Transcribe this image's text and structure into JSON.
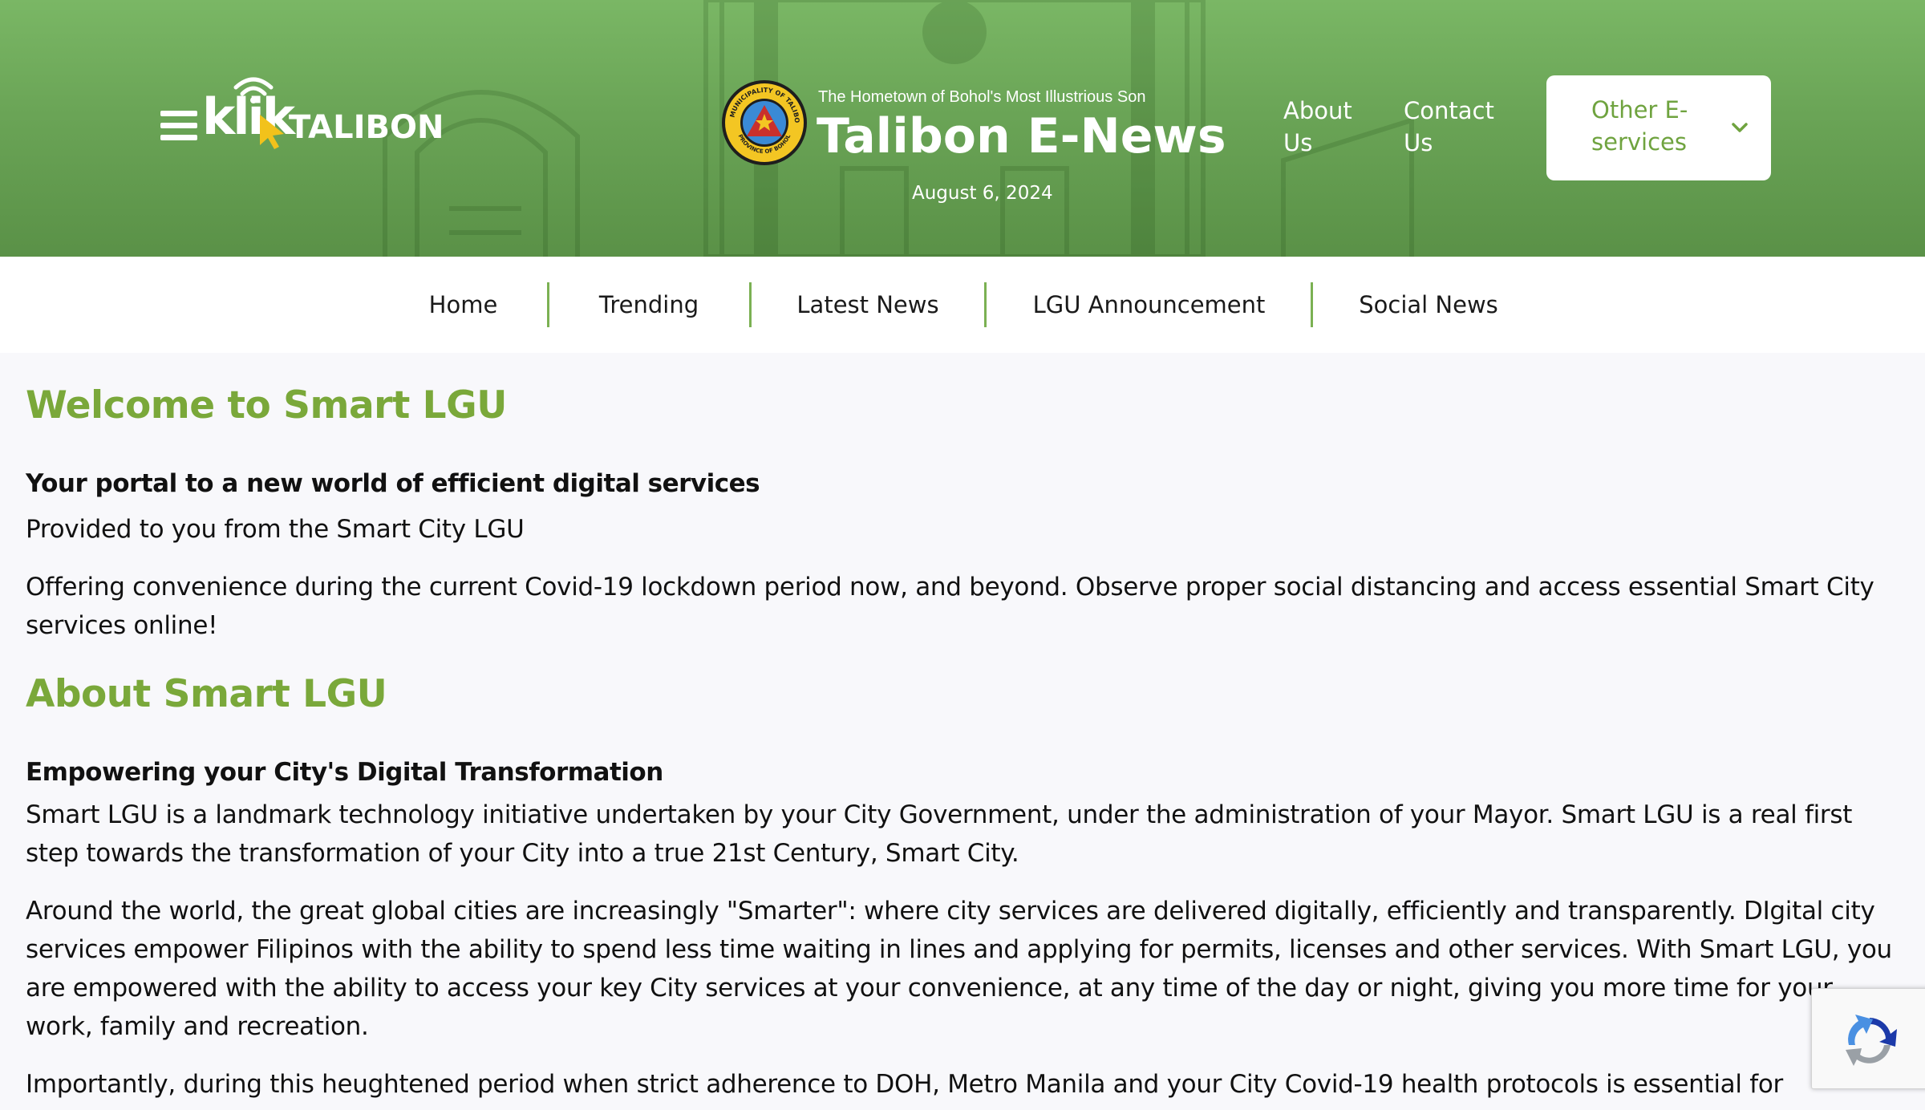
{
  "header": {
    "logo": {
      "brand": "klik",
      "town": "TALIBON"
    },
    "seal": {
      "text_top": "MUNICIPALITY OF TALIBON",
      "text_bottom": "PROVINCE OF BOHOL"
    },
    "tagline": "The Hometown of Bohol's Most Illustrious Son",
    "title": "Talibon E-News",
    "date": "August 6, 2024",
    "links": {
      "about": "About Us",
      "contact": "Contact Us"
    },
    "services_dropdown": {
      "label": "Other E-services"
    }
  },
  "nav": {
    "items": [
      {
        "label": "Home"
      },
      {
        "label": "Trending"
      },
      {
        "label": "Latest News"
      },
      {
        "label": "LGU Announcement"
      },
      {
        "label": "Social News"
      }
    ]
  },
  "content": {
    "welcome": {
      "heading": "Welcome to Smart LGU",
      "subheading": "Your portal to a new world of efficient digital services",
      "para1": "Provided to you from the Smart City LGU",
      "para2": "Offering convenience during the current Covid-19 lockdown period now, and beyond. Observe proper social distancing and access essential Smart City services online!"
    },
    "about": {
      "heading": "About Smart LGU",
      "subheading": "Empowering your City's Digital Transformation",
      "para1": "Smart LGU is a landmark technology initiative undertaken by your City Government, under the administration of your Mayor. Smart LGU is a real first step towards the transformation of your City into a true 21st Century, Smart City.",
      "para2": "Around the world, the great global cities are increasingly \"Smarter\": where city services are delivered digitally, efficiently and transparently. DIgital city services empower Filipinos with the ability to spend less time waiting in lines and applying for permits, licenses and other services. With Smart LGU, you are empowered with the ability to access your key City services at your convenience, at any time of the day or night, giving you more time for your work, family and recreation.",
      "para3": "Importantly, during this heughtened period when strict adherence to DOH, Metro Manila and your City Covid-19 health protocols is essential for"
    }
  },
  "colors": {
    "header_green": "#6aa456",
    "heading_green": "#7aa83a",
    "separator_green": "#7bb153",
    "dropdown_text": "#6fa33f",
    "logo_cursor": "#f2c21b"
  },
  "icons": {
    "menu": "hamburger-icon",
    "wifi": "wifi-icon",
    "cursor": "cursor-icon",
    "dropdown": "chevron-down-icon",
    "recaptcha": "recaptcha-icon"
  }
}
